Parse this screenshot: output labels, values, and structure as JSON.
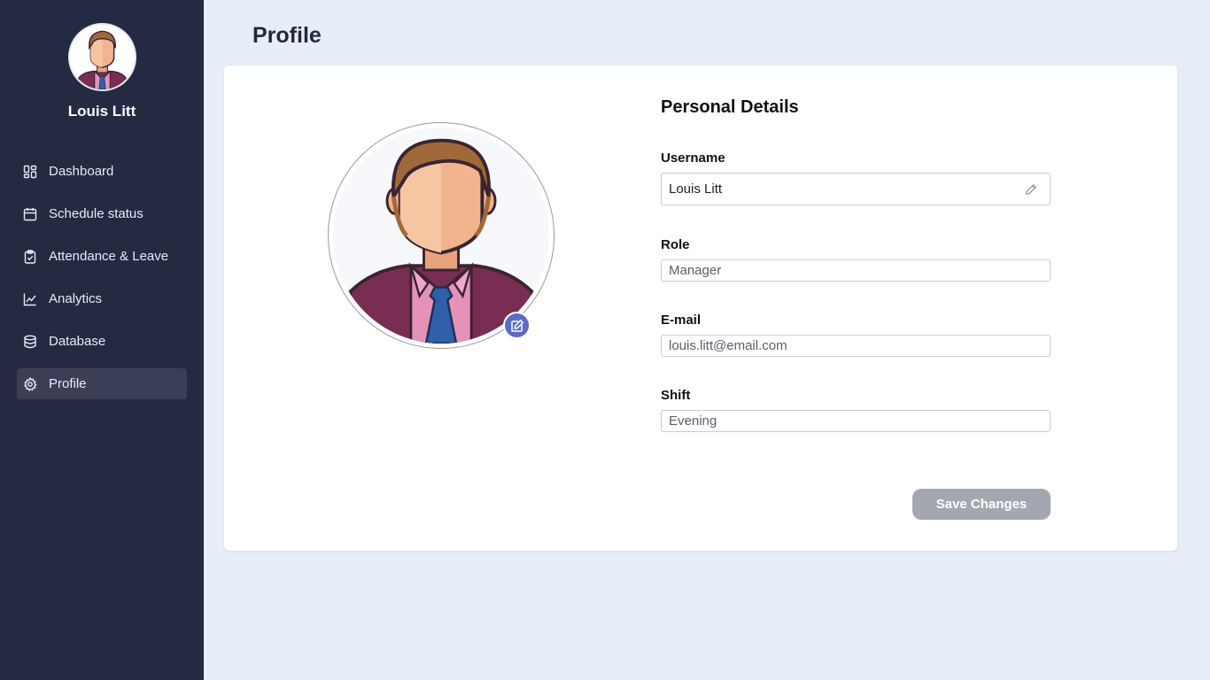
{
  "sidebar": {
    "user_name": "Louis Litt",
    "items": [
      {
        "label": "Dashboard",
        "icon": "dashboard-icon"
      },
      {
        "label": "Schedule status",
        "icon": "calendar-icon"
      },
      {
        "label": "Attendance & Leave",
        "icon": "clipboard-check-icon"
      },
      {
        "label": "Analytics",
        "icon": "line-chart-icon"
      },
      {
        "label": "Database",
        "icon": "database-icon"
      },
      {
        "label": "Profile",
        "icon": "gear-icon",
        "active": true
      }
    ]
  },
  "header": {
    "title": "Profile"
  },
  "details": {
    "title": "Personal Details",
    "username_label": "Username",
    "username_value": "Louis Litt",
    "role_label": "Role",
    "role_placeholder": "Manager",
    "email_label": "E-mail",
    "email_placeholder": "louis.litt@email.com",
    "shift_label": "Shift",
    "shift_placeholder": "Evening",
    "save_label": "Save Changes"
  },
  "colors": {
    "sidebar_bg": "#252a43",
    "page_bg": "#e8eef8",
    "accent": "#5b6cc4",
    "save_button": "#a3a7b0"
  }
}
